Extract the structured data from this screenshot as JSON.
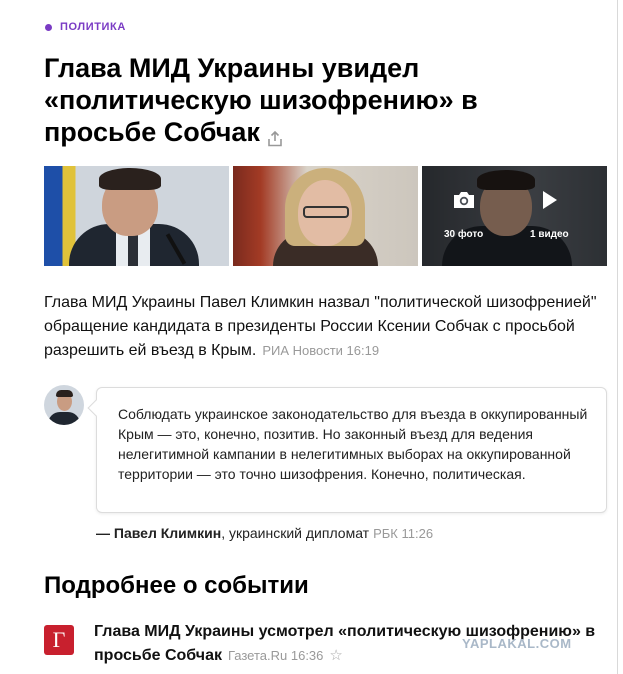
{
  "rubric": {
    "label": "ПОЛИТИКА"
  },
  "article": {
    "headline": "Глава МИД Украины увидел «политическую шизофрению» в просьбе Собчак",
    "lead": "Глава МИД Украины Павел Климкин назвал \"политической шизофренией\" обращение кандидата в президенты России Ксении Собчак с просьбой разрешить ей въезд в Крым.",
    "lead_source": "РИА Новости 16:19"
  },
  "gallery": {
    "photo_count": "30 фото",
    "video_count": "1 видео"
  },
  "quote": {
    "text": "Соблюдать украинское законодательство для въезда в оккупированный Крым — это, конечно, позитив. Но законный въезд для ведения нелегитимной кампании в нелегитимных выборах на оккупированной территории — это точно шизофрения. Конечно, политическая.",
    "dash": "—",
    "author": "Павел Климкин",
    "author_role": ", украинский дипломат",
    "source": "РБК 11:26"
  },
  "more": {
    "section_title": "Подробнее о событии",
    "items": [
      {
        "logo_letter": "Г",
        "title": "Глава МИД Украины усмотрел «политическую шизофрению» в просьбе Собчак",
        "source": "Газета.Ru 16:36"
      }
    ]
  },
  "watermark": "YAPLAKAL.COM",
  "colors": {
    "accent": "#7a3bc4",
    "logo_red": "#c8202e",
    "muted": "#999999"
  },
  "icons": [
    "share-icon",
    "camera-icon",
    "play-icon",
    "star-icon"
  ]
}
